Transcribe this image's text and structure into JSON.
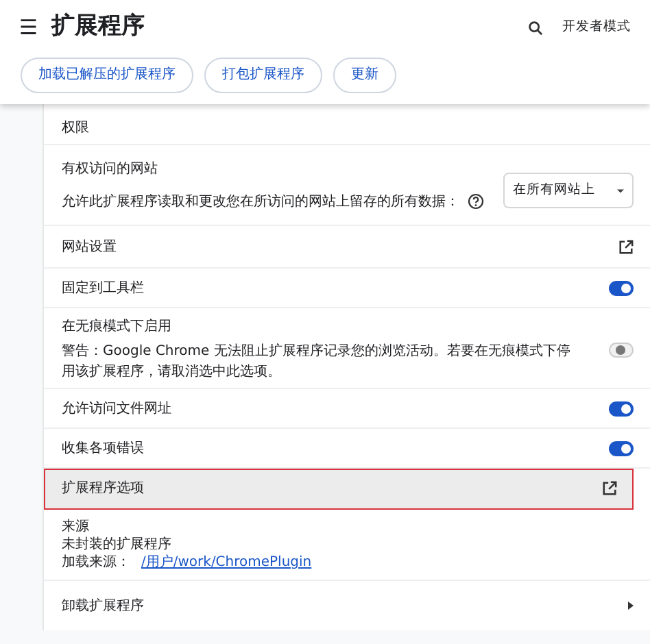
{
  "header": {
    "menu_icon": "☰",
    "title": "扩展程序",
    "developer_mode": "开发者模式"
  },
  "toolbar": {
    "buttons": [
      "加载已解压的扩展程序",
      "打包扩展程序",
      "更新"
    ]
  },
  "rows": [
    {
      "kind": "heading",
      "label": "权限"
    },
    {
      "kind": "sites",
      "label": "有权访问的网站",
      "description": "允许此扩展程序读取和更改您在所访问的网站上留存的所有数据：",
      "dropdown": "在所有网站上"
    },
    {
      "kind": "link",
      "label": "网站设置",
      "highlighted": false
    },
    {
      "kind": "toggle",
      "label": "固定到工具栏",
      "on": true
    },
    {
      "kind": "toggle",
      "label": "在无痕模式下启用",
      "warning": "警告：Google Chrome 无法阻止扩展程序记录您的浏览活动。若要在无痕模式下停用该扩展程序，请取消选中此选项。",
      "on": false
    },
    {
      "kind": "toggle",
      "label": "允许访问文件网址",
      "on": true
    },
    {
      "kind": "toggle",
      "label": "收集各项错误",
      "on": true
    },
    {
      "kind": "link",
      "label": "扩展程序选项",
      "highlighted": true
    },
    {
      "kind": "source",
      "label": "来源",
      "type": "未封装的扩展程序",
      "location_label": "加载来源：",
      "location": "/用户/work/ChromePlugin"
    },
    {
      "kind": "submenu",
      "label": "卸载扩展程序"
    }
  ]
}
